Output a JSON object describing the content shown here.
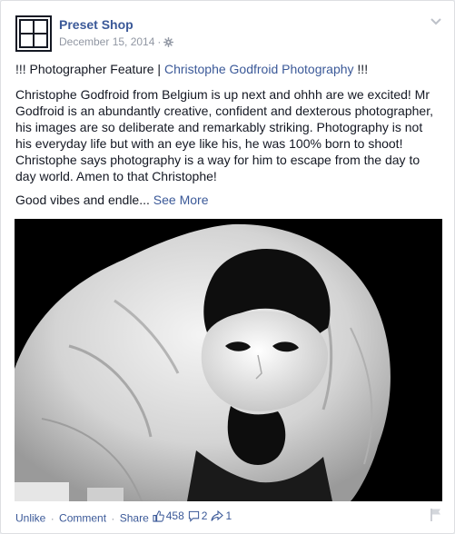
{
  "post": {
    "page_name": "Preset Shop",
    "date": "December 15, 2014",
    "audience_icon": "gear-icon",
    "headline_prefix": "!!! Photographer Feature | ",
    "headline_link": "Christophe Godfroid Photography",
    "headline_suffix": " !!!",
    "body": "Christophe Godfroid from Belgium is up next and ohhh are we excited! Mr Godfroid is an abundantly creative, confident and dexterous photographer, his images are so deliberate and remarkably striking. Photography is not his everyday life but with an eye like his, he was 100% born to shoot! Christophe says photography is a way for him to escape from the day to day world. Amen to that Christophe!",
    "teaser": "Good vibes and endle...",
    "see_more": "See More"
  },
  "footer": {
    "unlike": "Unlike",
    "comment": "Comment",
    "share": "Share",
    "likes": "458",
    "comments": "2",
    "shares": "1"
  },
  "colors": {
    "link": "#3b5998",
    "meta": "#9197a3",
    "text": "#141823"
  }
}
